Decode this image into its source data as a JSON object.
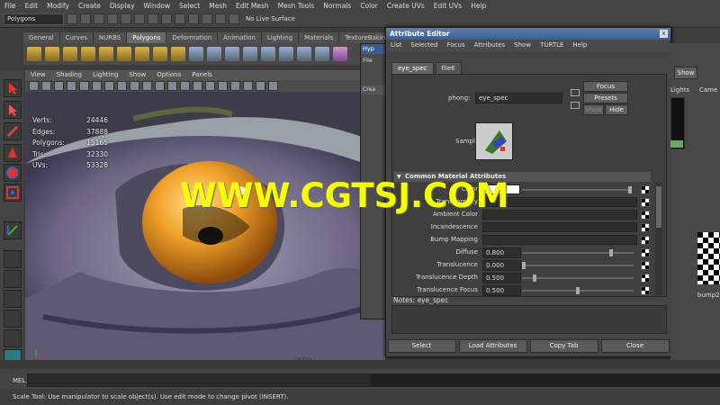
{
  "menubar": [
    "File",
    "Edit",
    "Modify",
    "Create",
    "Display",
    "Window",
    "Select",
    "Mesh",
    "Edit Mesh",
    "Mesh Tools",
    "Normals",
    "Color",
    "Create UVs",
    "Edit UVs",
    "Help"
  ],
  "status": {
    "mode": "Polygons",
    "live_surface": "No Live Surface"
  },
  "shelf_tabs": [
    "General",
    "Curves",
    "NURBS",
    "Polygons",
    "Deformation",
    "Animation",
    "Lighting",
    "Materials",
    "TextureBaking"
  ],
  "shelf_active": "Polygons",
  "viewport": {
    "menu": [
      "View",
      "Shading",
      "Lighting",
      "Show",
      "Options",
      "Panels"
    ],
    "hud": [
      {
        "label": "Verts:",
        "value": "24446"
      },
      {
        "label": "Edges:",
        "value": "37888"
      },
      {
        "label": "Polygons:",
        "value": "15165"
      },
      {
        "label": "Tris:",
        "value": "32330"
      },
      {
        "label": "UVs:",
        "value": "53328"
      }
    ],
    "camera_label": "persp"
  },
  "hypershade_fragment": {
    "title": "Hyp",
    "menu": "File",
    "tab": "Crea"
  },
  "attribute_editor": {
    "title": "Attribute Editor",
    "close": "x",
    "menu": [
      "List",
      "Selected",
      "Focus",
      "Attributes",
      "Show",
      "TURTLE",
      "Help"
    ],
    "tabs": [
      "eye_spec",
      "file6"
    ],
    "node_type": "phong:",
    "node_name": "eye_spec",
    "buttons": {
      "focus": "Focus",
      "presets": "Presets",
      "show": "Show",
      "hide": "Hide"
    },
    "sample_label": "Sample",
    "section": "Common Material Attributes",
    "attributes": [
      {
        "label": "Color",
        "value": ""
      },
      {
        "label": "Transparency",
        "value": ""
      },
      {
        "label": "Ambient Color",
        "value": ""
      },
      {
        "label": "Incandescence",
        "value": ""
      },
      {
        "label": "Bump Mapping",
        "value": ""
      },
      {
        "label": "Diffuse",
        "value": "0.800"
      },
      {
        "label": "Translucence",
        "value": "0.000"
      },
      {
        "label": "Translucence Depth",
        "value": "0.500"
      },
      {
        "label": "Translucence Focus",
        "value": "0.500"
      }
    ],
    "notes_label": "Notes: eye_spec",
    "bottom_buttons": [
      "Select",
      "Load Attributes",
      "Copy Tab",
      "Close"
    ]
  },
  "right_panel": {
    "show_button": "Show",
    "tabs": [
      "Lights",
      "Came"
    ],
    "node_label": "bump2"
  },
  "command_line": {
    "label": "MEL"
  },
  "help_line": "Scale Tool: Use manipulator to scale object(s). Use edit mode to change pivot (INSERT).",
  "watermark": "WWW.CGTSJ.COM",
  "colors": {
    "title_bar": "#3c5e8e",
    "eye_orange": "#e89a1d",
    "watermark": "#f6ff00"
  }
}
